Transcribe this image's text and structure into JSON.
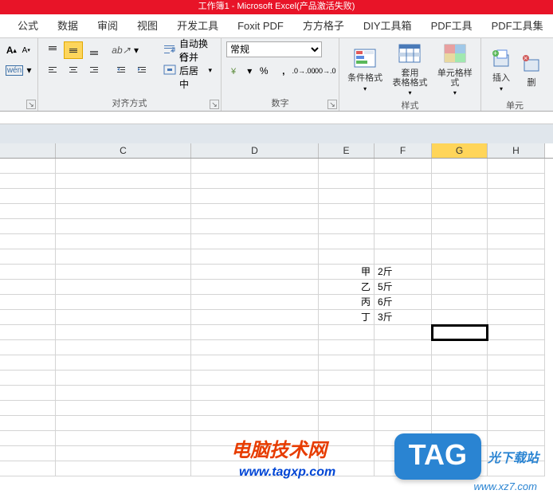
{
  "title_bar": "工作簿1 - Microsoft Excel(产品激活失败)",
  "tabs": [
    "公式",
    "数据",
    "审阅",
    "视图",
    "开发工具",
    "Foxit PDF",
    "方方格子",
    "DIY工具箱",
    "PDF工具",
    "PDF工具集"
  ],
  "ribbon": {
    "alignment": {
      "label": "对齐方式",
      "wrap_text": "自动换行",
      "merge_center": "合并后居中"
    },
    "number": {
      "label": "数字",
      "format": "常规"
    },
    "styles": {
      "label": "样式",
      "cond_format": "条件格式",
      "table_format": "套用\n表格格式",
      "cell_style": "单元格样式"
    },
    "cells": {
      "label": "单元",
      "insert": "插入",
      "delete": "删"
    }
  },
  "columns": [
    {
      "id": "B",
      "label": "",
      "w": 70
    },
    {
      "id": "C",
      "label": "C",
      "w": 170
    },
    {
      "id": "D",
      "label": "D",
      "w": 160
    },
    {
      "id": "E",
      "label": "E",
      "w": 70
    },
    {
      "id": "F",
      "label": "F",
      "w": 72
    },
    {
      "id": "G",
      "label": "G",
      "w": 70
    },
    {
      "id": "H",
      "label": "H",
      "w": 72
    }
  ],
  "selected_col": "G",
  "selected_cell": {
    "row": 12,
    "col": "G"
  },
  "cells": {
    "8": {
      "E": "甲",
      "F": "2斤"
    },
    "9": {
      "E": "乙",
      "F": "5斤"
    },
    "10": {
      "E": "丙",
      "F": "6斤"
    },
    "11": {
      "E": "丁",
      "F": "3斤"
    }
  },
  "row_count": 21,
  "watermark1": {
    "text": "电脑技术网",
    "url": "www.tagxp.com"
  },
  "watermark2": {
    "badge": "TAG",
    "text": "光下载站",
    "url": "www.xz7.com"
  }
}
